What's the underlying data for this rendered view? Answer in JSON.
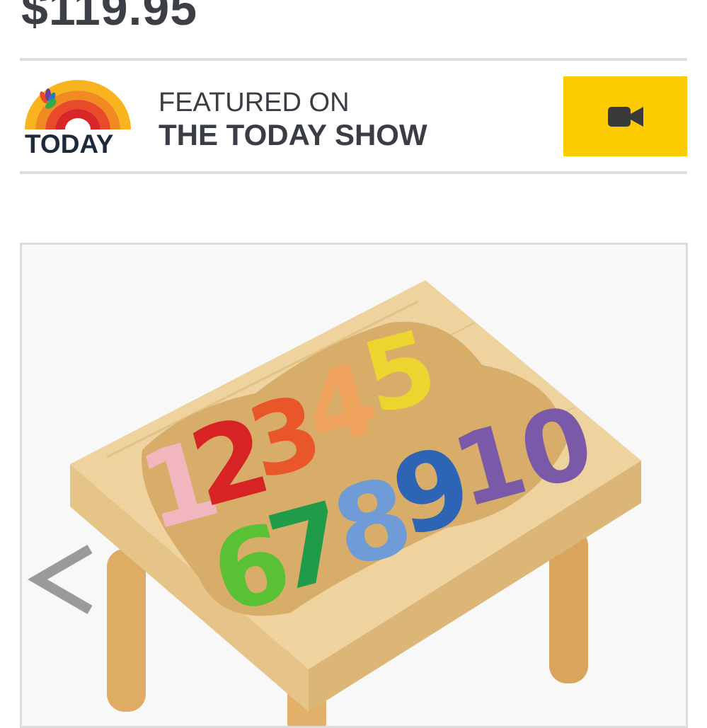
{
  "product": {
    "price": "$119.95"
  },
  "featured": {
    "logo_text": "TODAY",
    "line1": "FEATURED ON",
    "line2": "THE TODAY SHOW",
    "video_icon": "video-camera-icon",
    "button_color": "#fccc00"
  },
  "gallery": {
    "prev_icon": "chevron-left-icon",
    "image_alt": "Wooden step stool with colorful number puzzle 1-10"
  }
}
